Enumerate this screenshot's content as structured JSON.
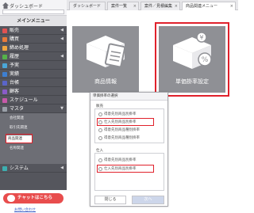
{
  "sidebar": {
    "app_title": "ダッシュボード",
    "search_placeholder": "",
    "menu_title": "メインメニュー",
    "items": [
      {
        "label": "販売",
        "icon": "cart-icon"
      },
      {
        "label": "購買",
        "icon": "bag-icon"
      },
      {
        "label": "締め処理",
        "icon": "closing-icon"
      },
      {
        "label": "履歴",
        "icon": "history-icon"
      },
      {
        "label": "予実",
        "icon": "forecast-icon"
      },
      {
        "label": "実績",
        "icon": "results-icon"
      },
      {
        "label": "台帳",
        "icon": "ledger-icon"
      },
      {
        "label": "顧客",
        "icon": "customer-icon"
      },
      {
        "label": "スケジュール",
        "icon": "calendar-icon"
      },
      {
        "label": "マスタ",
        "icon": "master-icon"
      },
      {
        "label": "システム",
        "icon": "system-icon"
      }
    ],
    "master_sub": [
      "会社関連",
      "取引先関連",
      "商品関連",
      "名称関連"
    ],
    "chat_label": "チャットはこちら",
    "help_link": "お問い合わせ"
  },
  "tabs": [
    {
      "label": "ダッシュボード"
    },
    {
      "label": "案件一覧"
    },
    {
      "label": "案件／見積編集"
    },
    {
      "label": "商品関連メニュー"
    }
  ],
  "cards": [
    {
      "label": "商品情報",
      "icon": "product-box-icon"
    },
    {
      "label": "単価掛率設定",
      "icon": "price-rate-box-icon"
    }
  ],
  "dialog": {
    "title": "単価掛率の選択",
    "group1_label": "販売",
    "group1_options": [
      "得意先別商品別掛率",
      "仕入先別商品別掛率",
      "得意先別商品種別掛率",
      "得意先別商品種別掛率"
    ],
    "group2_label": "仕入",
    "group2_options": [
      "得意先別商品別掛率",
      "仕入先別商品別掛率"
    ],
    "close_label": "閉じる",
    "next_label": "次へ"
  },
  "colors": {
    "sidebar_bg": "#55565d",
    "card_bg": "#8f9095",
    "highlight": "#e0212b",
    "chat_button": "#e84d4d"
  }
}
